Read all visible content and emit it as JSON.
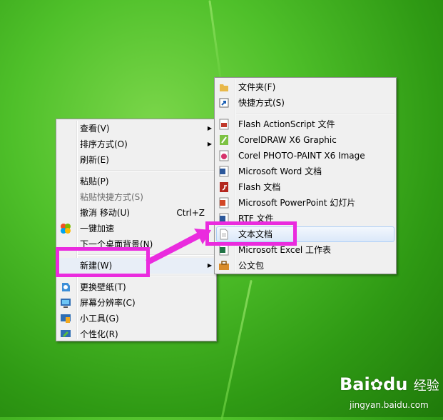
{
  "context_menu": {
    "items": [
      {
        "label": "查看(V)",
        "submenu": true
      },
      {
        "label": "排序方式(O)",
        "submenu": true
      },
      {
        "label": "刷新(E)"
      },
      {
        "label": "粘贴(P)"
      },
      {
        "label": "粘贴快捷方式(S)",
        "disabled": true
      },
      {
        "label": "撤消 移动(U)",
        "shortcut": "Ctrl+Z"
      },
      {
        "label": "一键加速"
      },
      {
        "label": "下一个桌面背景(N)"
      },
      {
        "label": "新建(W)",
        "submenu": true
      },
      {
        "label": "更换壁纸(T)"
      },
      {
        "label": "屏幕分辨率(C)"
      },
      {
        "label": "小工具(G)"
      },
      {
        "label": "个性化(R)"
      }
    ]
  },
  "new_submenu": {
    "items": [
      {
        "label": "文件夹(F)",
        "icon": "folder-icon"
      },
      {
        "label": "快捷方式(S)",
        "icon": "shortcut-icon"
      },
      {
        "label": "Flash ActionScript 文件",
        "icon": "flash-actionscript-icon"
      },
      {
        "label": "CorelDRAW X6 Graphic",
        "icon": "coreldraw-icon"
      },
      {
        "label": "Corel PHOTO-PAINT X6 Image",
        "icon": "photopaint-icon"
      },
      {
        "label": "Microsoft Word 文档",
        "icon": "word-icon"
      },
      {
        "label": "Flash 文档",
        "icon": "flash-icon"
      },
      {
        "label": "Microsoft PowerPoint 幻灯片",
        "icon": "powerpoint-icon"
      },
      {
        "label": "RTF 文件",
        "icon": "rtf-icon"
      },
      {
        "label": "文本文档",
        "icon": "text-document-icon"
      },
      {
        "label": "Microsoft Excel 工作表",
        "icon": "excel-icon"
      },
      {
        "label": "公文包",
        "icon": "briefcase-icon"
      }
    ]
  },
  "watermark": {
    "brand": "Bai",
    "brand2": "du",
    "suffix": "经验",
    "url": "jingyan.baidu.com"
  },
  "colors": {
    "highlight": "#ea2bde",
    "hover_border": "#aecff7"
  }
}
